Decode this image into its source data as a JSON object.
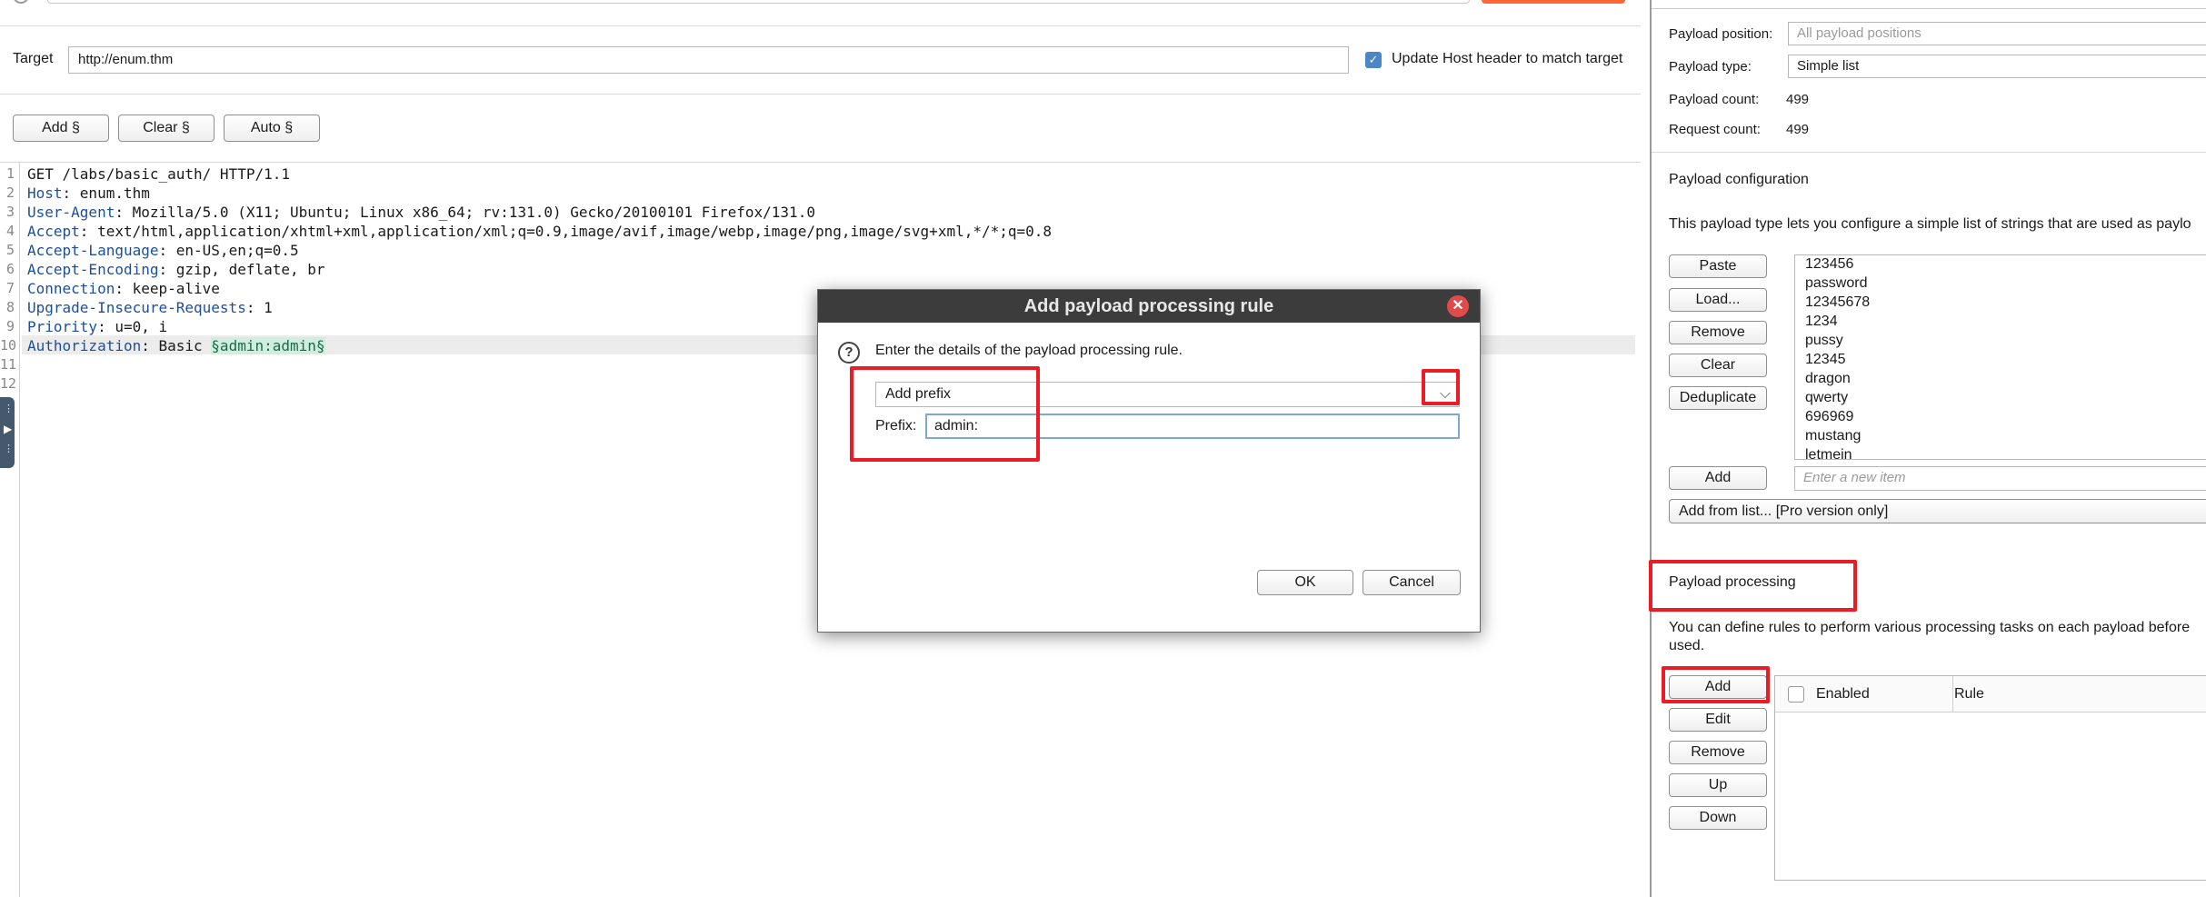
{
  "intruder": {
    "target_label": "Target",
    "target_value": "http://enum.thm",
    "update_host_label": "Update Host header to match target",
    "update_host_checked": true,
    "buttons": {
      "add": "Add §",
      "clear": "Clear §",
      "auto": "Auto §"
    },
    "request_lines": [
      {
        "num": "1",
        "key": "GET /labs/basic_auth/ HTTP/1.1",
        "value": ""
      },
      {
        "num": "2",
        "key": "Host",
        "value": ": enum.thm"
      },
      {
        "num": "3",
        "key": "User-Agent",
        "value": ": Mozilla/5.0 (X11; Ubuntu; Linux x86_64; rv:131.0) Gecko/20100101 Firefox/131.0"
      },
      {
        "num": "4",
        "key": "Accept",
        "value": ": text/html,application/xhtml+xml,application/xml;q=0.9,image/avif,image/webp,image/png,image/svg+xml,*/*;q=0.8"
      },
      {
        "num": "5",
        "key": "Accept-Language",
        "value": ": en-US,en;q=0.5"
      },
      {
        "num": "6",
        "key": "Accept-Encoding",
        "value": ": gzip, deflate, br"
      },
      {
        "num": "7",
        "key": "Connection",
        "value": ": keep-alive"
      },
      {
        "num": "8",
        "key": "Upgrade-Insecure-Requests",
        "value": ": 1"
      },
      {
        "num": "9",
        "key": "Priority",
        "value": ": u=0, i"
      },
      {
        "num": "10",
        "key": "Authorization",
        "value": ": Basic ",
        "marker": "§admin:admin§"
      },
      {
        "num": "11",
        "key": "",
        "value": ""
      },
      {
        "num": "12",
        "key": "",
        "value": ""
      }
    ]
  },
  "payloads": {
    "position_label": "Payload position:",
    "position_value": "All payload positions",
    "type_label": "Payload type:",
    "type_value": "Simple list",
    "count_label": "Payload count:",
    "count_value": "499",
    "request_label": "Request count:",
    "request_value": "499",
    "config_title": "Payload configuration",
    "config_desc": "This payload type lets you configure a simple list of strings that are used as paylo",
    "list_buttons": [
      "Paste",
      "Load...",
      "Remove",
      "Clear",
      "Deduplicate"
    ],
    "list_items": [
      "123456",
      "password",
      "12345678",
      "1234",
      "pussy",
      "12345",
      "dragon",
      "qwerty",
      "696969",
      "mustang",
      "letmein"
    ],
    "add_label": "Add",
    "new_item_placeholder": "Enter a new item",
    "add_from_list": "Add from list... [Pro version only]",
    "processing_title": "Payload processing",
    "processing_desc_1": "You can define rules to perform various processing tasks on each payload before",
    "processing_desc_2": "used.",
    "processing_buttons": [
      "Add",
      "Edit",
      "Remove",
      "Up",
      "Down"
    ],
    "table_columns": [
      "Enabled",
      "Rule"
    ]
  },
  "dialog": {
    "title": "Add payload processing rule",
    "intro": "Enter the details of the payload processing rule.",
    "rule_type": "Add prefix",
    "prefix_label": "Prefix:",
    "prefix_value": "admin:",
    "ok": "OK",
    "cancel": "Cancel"
  },
  "colors": {
    "accent": "#ff6633",
    "highlight_box": "#ec1c24",
    "checkbox": "#4a86c8",
    "dialog_title_bg": "#3c3c3c",
    "header_key": "#1c4f9c",
    "payload_marker_bg": "#cfeee0"
  },
  "icons": {
    "close": "close-icon",
    "help": "help-icon",
    "dropdown": "chevron-down-icon",
    "checkbox": "checkbox-icon"
  }
}
